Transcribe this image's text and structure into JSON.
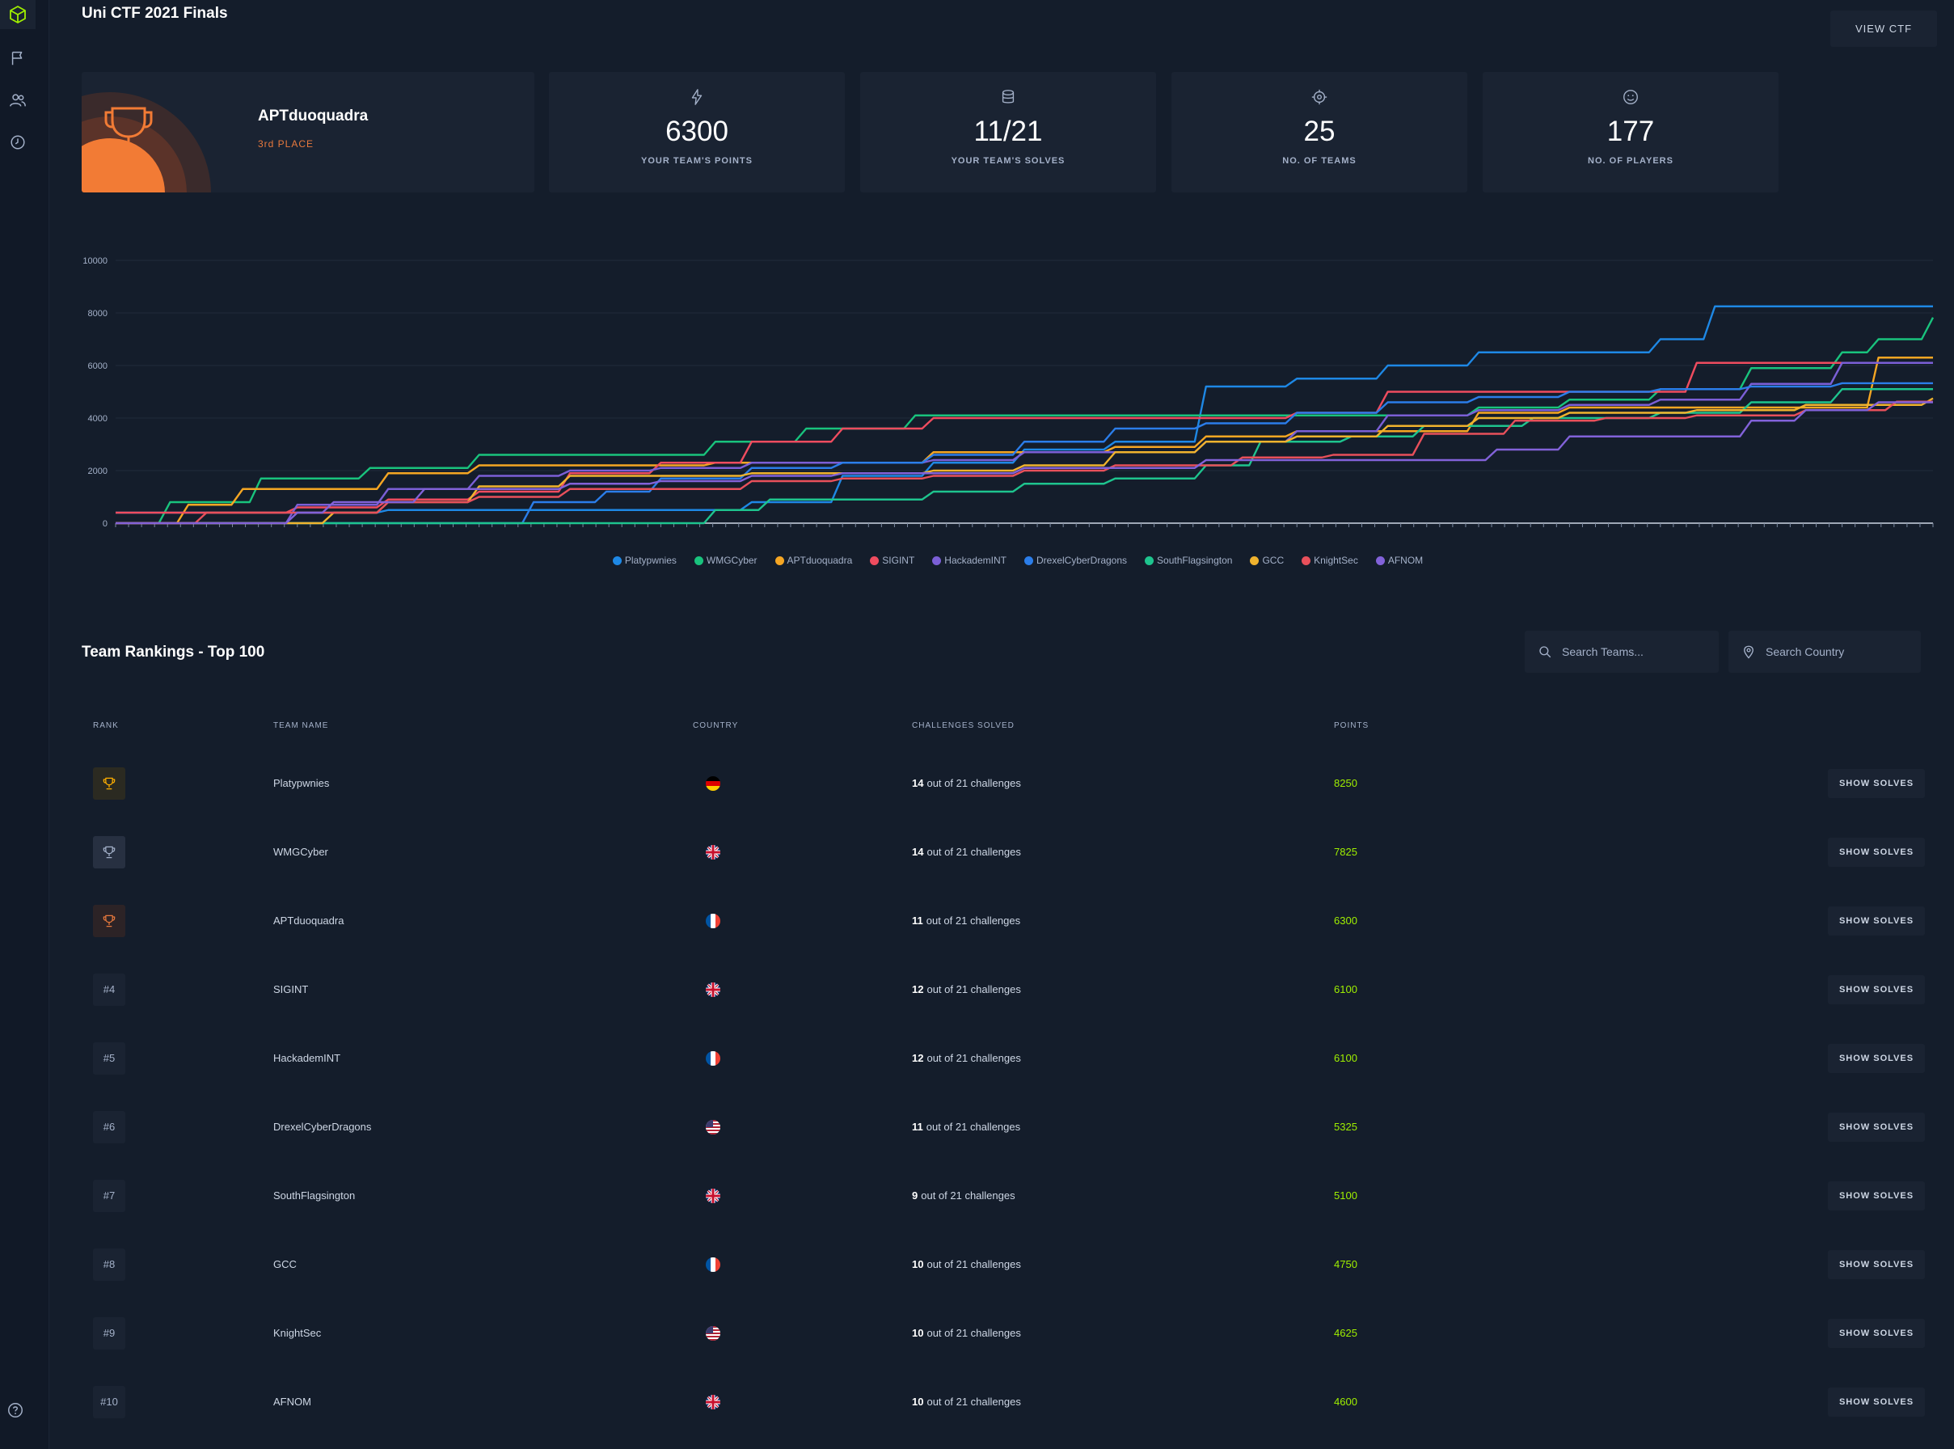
{
  "colors": {
    "brand": "#9fef00",
    "bronze": "#e8793d",
    "gold": "#ffaf00",
    "silver": "#a4b1c9",
    "background": "#141d2b",
    "panel": "#1a2332"
  },
  "sidebar": {
    "items": [
      {
        "icon": "cube-logo-icon"
      },
      {
        "icon": "flag-icon"
      },
      {
        "icon": "users-icon"
      },
      {
        "icon": "clock-icon"
      }
    ],
    "footer_icon": "help-icon"
  },
  "header": {
    "title": "Uni CTF 2021 Finals",
    "view_button": "VIEW CTF"
  },
  "team_card": {
    "name": "APTduoquadra",
    "place": "3rd PLACE"
  },
  "stats": [
    {
      "icon": "bolt-icon",
      "value": "6300",
      "label": "YOUR TEAM'S POINTS"
    },
    {
      "icon": "database-icon",
      "value": "11/21",
      "label": "YOUR TEAM'S SOLVES"
    },
    {
      "icon": "target-icon",
      "value": "25",
      "label": "NO. OF TEAMS"
    },
    {
      "icon": "smile-icon",
      "value": "177",
      "label": "NO. OF PLAYERS"
    }
  ],
  "chart_data": {
    "type": "line",
    "title": "",
    "xlabel": "",
    "ylabel": "",
    "ylim": [
      0,
      10000
    ],
    "yticks": [
      "0",
      "2000",
      "4000",
      "6000",
      "8000",
      "10000"
    ],
    "grid": true,
    "legend_position": "bottom",
    "series": [
      {
        "name": "Platypwnies",
        "color": "#1e88e5",
        "points": [
          [
            0,
            400
          ],
          [
            0.05,
            400
          ],
          [
            0.1,
            400
          ],
          [
            0.15,
            500
          ],
          [
            0.2,
            500
          ],
          [
            0.25,
            500
          ],
          [
            0.3,
            500
          ],
          [
            0.35,
            800
          ],
          [
            0.4,
            1800
          ],
          [
            0.45,
            2300
          ],
          [
            0.5,
            2800
          ],
          [
            0.55,
            3100
          ],
          [
            0.6,
            5200
          ],
          [
            0.65,
            5500
          ],
          [
            0.7,
            6000
          ],
          [
            0.75,
            6500
          ],
          [
            0.8,
            6500
          ],
          [
            0.85,
            7000
          ],
          [
            0.88,
            8250
          ],
          [
            1,
            8250
          ]
        ]
      },
      {
        "name": "WMGCyber",
        "color": "#19c37d",
        "points": [
          [
            0,
            0
          ],
          [
            0.03,
            800
          ],
          [
            0.08,
            1700
          ],
          [
            0.14,
            2100
          ],
          [
            0.2,
            2600
          ],
          [
            0.28,
            2600
          ],
          [
            0.33,
            3100
          ],
          [
            0.38,
            3600
          ],
          [
            0.44,
            4100
          ],
          [
            0.5,
            4100
          ],
          [
            0.6,
            4100
          ],
          [
            0.7,
            4100
          ],
          [
            0.75,
            4400
          ],
          [
            0.8,
            4700
          ],
          [
            0.85,
            5100
          ],
          [
            0.9,
            5900
          ],
          [
            0.95,
            6500
          ],
          [
            0.97,
            7000
          ],
          [
            1,
            7825
          ]
        ]
      },
      {
        "name": "APTduoquadra",
        "color": "#f5a623",
        "points": [
          [
            0,
            0
          ],
          [
            0.04,
            700
          ],
          [
            0.07,
            1300
          ],
          [
            0.11,
            1300
          ],
          [
            0.15,
            1900
          ],
          [
            0.2,
            2200
          ],
          [
            0.28,
            2200
          ],
          [
            0.33,
            2300
          ],
          [
            0.38,
            2300
          ],
          [
            0.45,
            2700
          ],
          [
            0.5,
            2700
          ],
          [
            0.55,
            2900
          ],
          [
            0.6,
            3300
          ],
          [
            0.65,
            3500
          ],
          [
            0.7,
            3500
          ],
          [
            0.75,
            4200
          ],
          [
            0.8,
            4400
          ],
          [
            0.85,
            4400
          ],
          [
            0.9,
            4400
          ],
          [
            0.97,
            6300
          ],
          [
            1,
            6300
          ]
        ]
      },
      {
        "name": "SIGINT",
        "color": "#ef4c5f",
        "points": [
          [
            0,
            400
          ],
          [
            0.05,
            400
          ],
          [
            0.1,
            600
          ],
          [
            0.15,
            900
          ],
          [
            0.2,
            1200
          ],
          [
            0.25,
            1900
          ],
          [
            0.3,
            2300
          ],
          [
            0.35,
            3100
          ],
          [
            0.4,
            3600
          ],
          [
            0.45,
            4000
          ],
          [
            0.5,
            4000
          ],
          [
            0.55,
            4000
          ],
          [
            0.6,
            4000
          ],
          [
            0.65,
            4200
          ],
          [
            0.7,
            5000
          ],
          [
            0.75,
            5000
          ],
          [
            0.8,
            5000
          ],
          [
            0.87,
            6100
          ],
          [
            1,
            6100
          ]
        ]
      },
      {
        "name": "HackademINT",
        "color": "#7b5fd6",
        "points": [
          [
            0,
            0
          ],
          [
            0.05,
            0
          ],
          [
            0.1,
            700
          ],
          [
            0.15,
            1300
          ],
          [
            0.2,
            1800
          ],
          [
            0.25,
            2000
          ],
          [
            0.3,
            2100
          ],
          [
            0.35,
            2300
          ],
          [
            0.4,
            2300
          ],
          [
            0.45,
            2400
          ],
          [
            0.5,
            2700
          ],
          [
            0.55,
            2700
          ],
          [
            0.6,
            3100
          ],
          [
            0.65,
            3500
          ],
          [
            0.7,
            4100
          ],
          [
            0.75,
            4300
          ],
          [
            0.8,
            4500
          ],
          [
            0.85,
            4700
          ],
          [
            0.9,
            5300
          ],
          [
            0.95,
            6100
          ],
          [
            1,
            6100
          ]
        ]
      },
      {
        "name": "DrexelCyberDragons",
        "color": "#2b7de9",
        "points": [
          [
            0,
            0
          ],
          [
            0.2,
            0
          ],
          [
            0.23,
            800
          ],
          [
            0.27,
            1200
          ],
          [
            0.3,
            1700
          ],
          [
            0.35,
            2100
          ],
          [
            0.4,
            2300
          ],
          [
            0.45,
            2600
          ],
          [
            0.5,
            3100
          ],
          [
            0.55,
            3600
          ],
          [
            0.6,
            3800
          ],
          [
            0.65,
            4200
          ],
          [
            0.7,
            4600
          ],
          [
            0.75,
            4800
          ],
          [
            0.8,
            5000
          ],
          [
            0.85,
            5100
          ],
          [
            0.9,
            5200
          ],
          [
            0.95,
            5325
          ],
          [
            1,
            5325
          ]
        ]
      },
      {
        "name": "SouthFlagsington",
        "color": "#1ec48e",
        "points": [
          [
            0,
            0
          ],
          [
            0.3,
            0
          ],
          [
            0.33,
            500
          ],
          [
            0.36,
            900
          ],
          [
            0.42,
            900
          ],
          [
            0.45,
            1200
          ],
          [
            0.5,
            1500
          ],
          [
            0.55,
            1700
          ],
          [
            0.6,
            2200
          ],
          [
            0.63,
            3100
          ],
          [
            0.68,
            3300
          ],
          [
            0.72,
            3700
          ],
          [
            0.78,
            4000
          ],
          [
            0.85,
            4200
          ],
          [
            0.9,
            4600
          ],
          [
            0.95,
            5100
          ],
          [
            1,
            5100
          ]
        ]
      },
      {
        "name": "GCC",
        "color": "#f0b32e",
        "points": [
          [
            0,
            0
          ],
          [
            0.1,
            0
          ],
          [
            0.12,
            400
          ],
          [
            0.15,
            800
          ],
          [
            0.2,
            1400
          ],
          [
            0.25,
            1800
          ],
          [
            0.3,
            1800
          ],
          [
            0.35,
            1900
          ],
          [
            0.4,
            1900
          ],
          [
            0.45,
            2000
          ],
          [
            0.5,
            2200
          ],
          [
            0.55,
            2700
          ],
          [
            0.6,
            3100
          ],
          [
            0.65,
            3300
          ],
          [
            0.7,
            3700
          ],
          [
            0.75,
            4000
          ],
          [
            0.8,
            4200
          ],
          [
            0.87,
            4300
          ],
          [
            0.93,
            4500
          ],
          [
            1,
            4750
          ]
        ]
      },
      {
        "name": "KnightSec",
        "color": "#e8505b",
        "points": [
          [
            0,
            0
          ],
          [
            0.05,
            400
          ],
          [
            0.1,
            400
          ],
          [
            0.15,
            800
          ],
          [
            0.2,
            1000
          ],
          [
            0.25,
            1300
          ],
          [
            0.3,
            1300
          ],
          [
            0.35,
            1600
          ],
          [
            0.4,
            1700
          ],
          [
            0.45,
            1800
          ],
          [
            0.5,
            2000
          ],
          [
            0.55,
            2200
          ],
          [
            0.6,
            2200
          ],
          [
            0.62,
            2500
          ],
          [
            0.67,
            2600
          ],
          [
            0.72,
            3400
          ],
          [
            0.77,
            3900
          ],
          [
            0.82,
            4000
          ],
          [
            0.87,
            4100
          ],
          [
            0.93,
            4300
          ],
          [
            0.98,
            4625
          ],
          [
            1,
            4625
          ]
        ]
      },
      {
        "name": "AFNOM",
        "color": "#8262d9",
        "points": [
          [
            0,
            0
          ],
          [
            0.07,
            0
          ],
          [
            0.1,
            400
          ],
          [
            0.12,
            800
          ],
          [
            0.17,
            1300
          ],
          [
            0.2,
            1300
          ],
          [
            0.25,
            1500
          ],
          [
            0.3,
            1600
          ],
          [
            0.35,
            1800
          ],
          [
            0.4,
            1900
          ],
          [
            0.45,
            1900
          ],
          [
            0.5,
            2100
          ],
          [
            0.55,
            2100
          ],
          [
            0.6,
            2400
          ],
          [
            0.65,
            2400
          ],
          [
            0.72,
            2400
          ],
          [
            0.76,
            2800
          ],
          [
            0.8,
            3300
          ],
          [
            0.85,
            3300
          ],
          [
            0.9,
            3900
          ],
          [
            0.93,
            4300
          ],
          [
            0.97,
            4600
          ],
          [
            1,
            4600
          ]
        ]
      }
    ]
  },
  "rankings": {
    "title": "Team Rankings - Top 100",
    "search_teams_placeholder": "Search Teams...",
    "search_country_placeholder": "Search Country",
    "columns": {
      "rank": "RANK",
      "team": "TEAM NAME",
      "country": "COUNTRY",
      "solved": "CHALLENGES SOLVED",
      "points": "POINTS"
    },
    "rows": [
      {
        "rank": "",
        "medal": "gold",
        "team": "Platypwnies",
        "flag": "de",
        "solved": "14",
        "solved_suffix": "out of 21 challenges",
        "points": "8250",
        "button": "SHOW SOLVES"
      },
      {
        "rank": "",
        "medal": "silver",
        "team": "WMGCyber",
        "flag": "gb",
        "solved": "14",
        "solved_suffix": "out of 21 challenges",
        "points": "7825",
        "button": "SHOW SOLVES"
      },
      {
        "rank": "",
        "medal": "bronze",
        "team": "APTduoquadra",
        "flag": "fr",
        "solved": "11",
        "solved_suffix": "out of 21 challenges",
        "points": "6300",
        "button": "SHOW SOLVES"
      },
      {
        "rank": "#4",
        "medal": "",
        "team": "SIGINT",
        "flag": "gb",
        "solved": "12",
        "solved_suffix": "out of 21 challenges",
        "points": "6100",
        "button": "SHOW SOLVES"
      },
      {
        "rank": "#5",
        "medal": "",
        "team": "HackademINT",
        "flag": "fr",
        "solved": "12",
        "solved_suffix": "out of 21 challenges",
        "points": "6100",
        "button": "SHOW SOLVES"
      },
      {
        "rank": "#6",
        "medal": "",
        "team": "DrexelCyberDragons",
        "flag": "us",
        "solved": "11",
        "solved_suffix": "out of 21 challenges",
        "points": "5325",
        "button": "SHOW SOLVES"
      },
      {
        "rank": "#7",
        "medal": "",
        "team": "SouthFlagsington",
        "flag": "gb",
        "solved": "9",
        "solved_suffix": "out of 21 challenges",
        "points": "5100",
        "button": "SHOW SOLVES"
      },
      {
        "rank": "#8",
        "medal": "",
        "team": "GCC",
        "flag": "fr",
        "solved": "10",
        "solved_suffix": "out of 21 challenges",
        "points": "4750",
        "button": "SHOW SOLVES"
      },
      {
        "rank": "#9",
        "medal": "",
        "team": "KnightSec",
        "flag": "us",
        "solved": "10",
        "solved_suffix": "out of 21 challenges",
        "points": "4625",
        "button": "SHOW SOLVES"
      },
      {
        "rank": "#10",
        "medal": "",
        "team": "AFNOM",
        "flag": "gb",
        "solved": "10",
        "solved_suffix": "out of 21 challenges",
        "points": "4600",
        "button": "SHOW SOLVES"
      }
    ]
  }
}
